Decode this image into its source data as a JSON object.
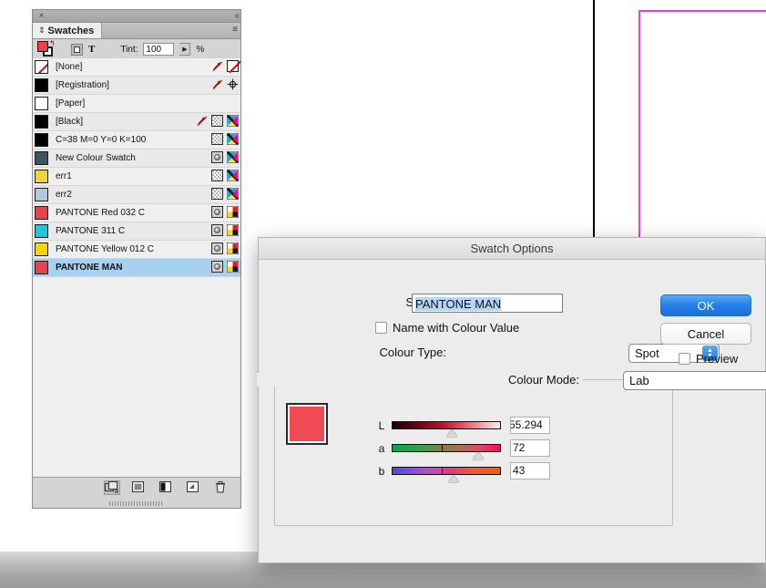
{
  "canvas": {
    "page_edge_color": "#000000",
    "bleed_guide_color": "#e93fe9"
  },
  "swatches_panel": {
    "close_glyph": "×",
    "collapse_glyph": "«",
    "tab_grip_glyph": "⇕",
    "tab_label": "Swatches",
    "menu_glyph": "≡",
    "toolbar": {
      "swap_glyph": "↰",
      "fill_color": "#ef4050",
      "formatting_container_name": "formatting-affects-container",
      "formatting_text_label": "T",
      "tint_label": "Tint:",
      "tint_value": "100",
      "tint_stepper_glyph": "▶",
      "percent_label": "%"
    },
    "rows": [
      {
        "name": "[None]",
        "chip": "none",
        "bold": false,
        "icons": [
          "noprint",
          "noneswatch"
        ]
      },
      {
        "name": "[Registration]",
        "chip": "#000000",
        "bold": false,
        "icons": [
          "noprint",
          "registration"
        ]
      },
      {
        "name": "[Paper]",
        "chip": "#ffffff",
        "bold": false,
        "icons": []
      },
      {
        "name": "[Black]",
        "chip": "#000000",
        "bold": false,
        "icons": [
          "noprint",
          "lab",
          "cmyk"
        ]
      },
      {
        "name": "C=38 M=0 Y=0 K=100",
        "chip": "#000000",
        "bold": false,
        "icons": [
          "lab",
          "cmyk"
        ]
      },
      {
        "name": "New Colour Swatch",
        "chip": "#3d5560",
        "bold": false,
        "icons": [
          "spot",
          "cmyk"
        ]
      },
      {
        "name": "err1",
        "chip": "#f0d430",
        "bold": false,
        "icons": [
          "lab",
          "cmyk"
        ]
      },
      {
        "name": "err2",
        "chip": "#afc8df",
        "bold": false,
        "icons": [
          "lab",
          "cmyk"
        ]
      },
      {
        "name": "PANTONE Red 032 C",
        "chip": "#ef4050",
        "bold": false,
        "icons": [
          "spot",
          "process"
        ]
      },
      {
        "name": "PANTONE 311 C",
        "chip": "#1ec8dc",
        "bold": false,
        "icons": [
          "spot",
          "process"
        ]
      },
      {
        "name": "PANTONE Yellow 012 C",
        "chip": "#ffd400",
        "bold": false,
        "icons": [
          "spot",
          "process"
        ]
      },
      {
        "name": "PANTONE MAN",
        "chip": "#ef4050",
        "bold": true,
        "icons": [
          "spot",
          "process"
        ],
        "selected": true
      }
    ],
    "footer_buttons": [
      {
        "name": "show-swatch-groups-button",
        "active": true
      },
      {
        "name": "new-colour-group-button",
        "active": false
      },
      {
        "name": "new-tint-swatch-button",
        "active": false
      },
      {
        "name": "new-swatch-button",
        "active": false
      },
      {
        "name": "delete-swatch-button",
        "active": false
      }
    ]
  },
  "dialog": {
    "title": "Swatch Options",
    "swatch_name_label": "Swatch Name:",
    "swatch_name_value": "PANTONE MAN",
    "name_with_colour_value_label": "Name with Colour Value",
    "name_with_colour_value_checked": false,
    "colour_type_label": "Colour Type:",
    "colour_type_value": "Spot",
    "colour_mode_label": "Colour Mode:",
    "colour_mode_value": "Lab",
    "preview_swatch_color": "#f04a55",
    "sliders": [
      {
        "label": "L",
        "value": "55.294",
        "thumb_pct": 55,
        "tick_pct": null
      },
      {
        "label": "a",
        "value": "72",
        "thumb_pct": 80,
        "tick_pct": 46
      },
      {
        "label": "b",
        "value": "43",
        "thumb_pct": 57,
        "tick_pct": 46
      }
    ],
    "ok_label": "OK",
    "cancel_label": "Cancel",
    "preview_label": "Preview",
    "preview_checked": false,
    "select_arrow_up": "▲",
    "select_arrow_down": "▼"
  }
}
